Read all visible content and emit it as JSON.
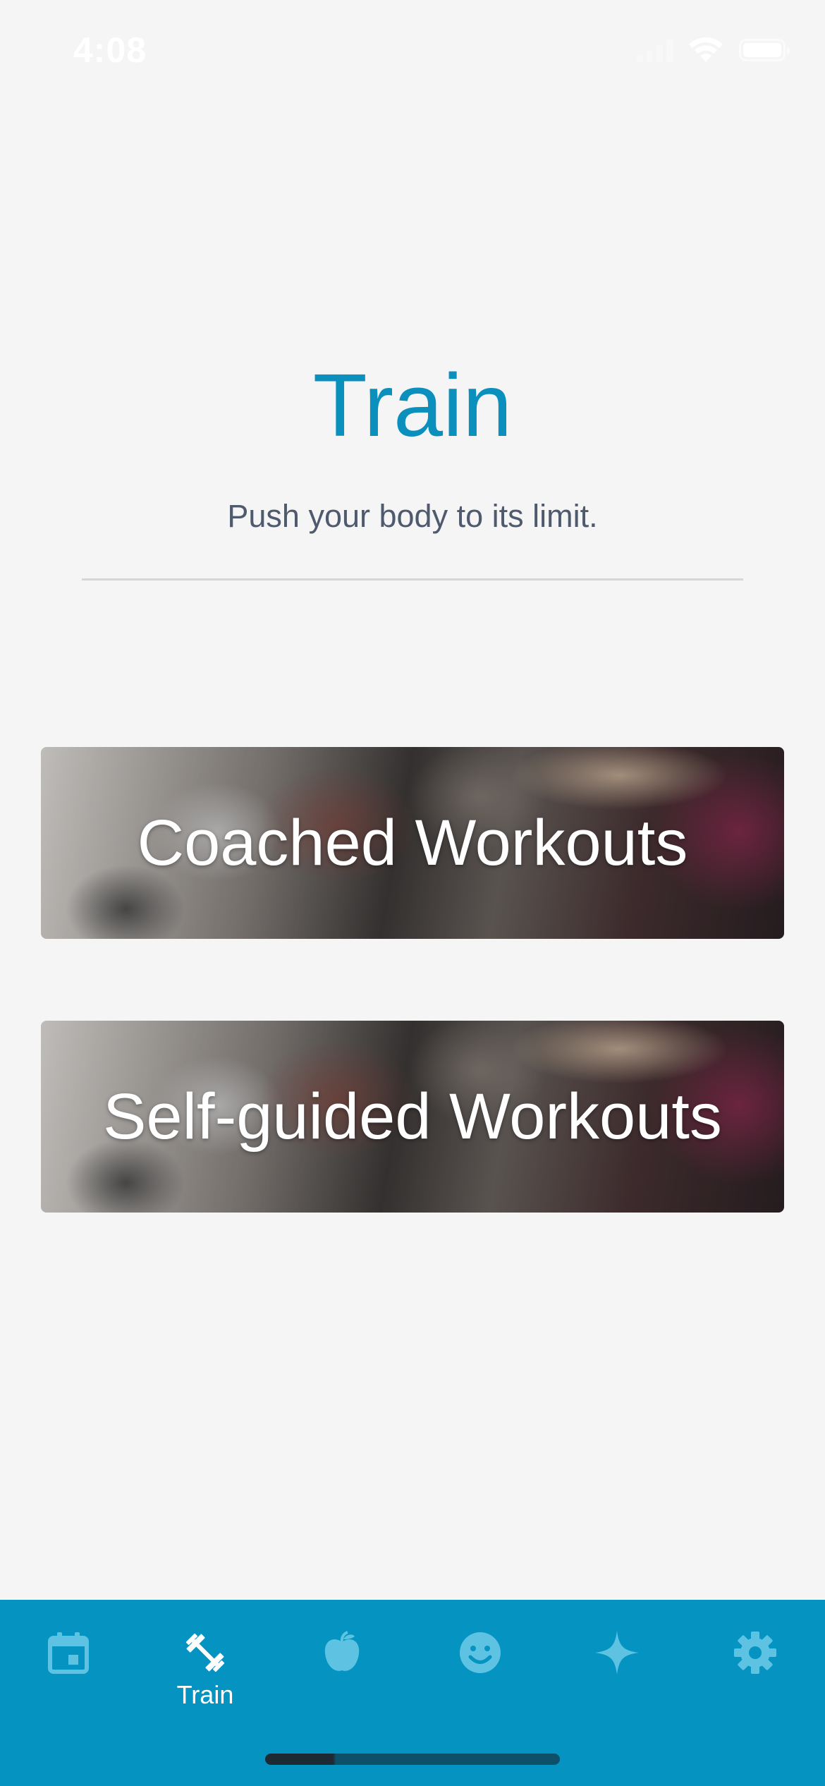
{
  "status_bar": {
    "time": "4:08"
  },
  "header": {
    "title": "Train",
    "subtitle": "Push your body to its limit."
  },
  "cards": [
    {
      "label": "Coached Workouts"
    },
    {
      "label": "Self-guided Workouts"
    }
  ],
  "tab_bar": {
    "active_index": 1,
    "items": [
      {
        "icon": "calendar-icon",
        "label": ""
      },
      {
        "icon": "dumbbell-icon",
        "label": "Train"
      },
      {
        "icon": "apple-icon",
        "label": ""
      },
      {
        "icon": "smiley-icon",
        "label": ""
      },
      {
        "icon": "sparkle-icon",
        "label": ""
      },
      {
        "icon": "gear-icon",
        "label": ""
      }
    ]
  },
  "colors": {
    "accent": "#0b8fbc",
    "tab_bar": "#0593c1",
    "inactive_icon": "#5ec3e2",
    "background": "#f5f5f5"
  }
}
